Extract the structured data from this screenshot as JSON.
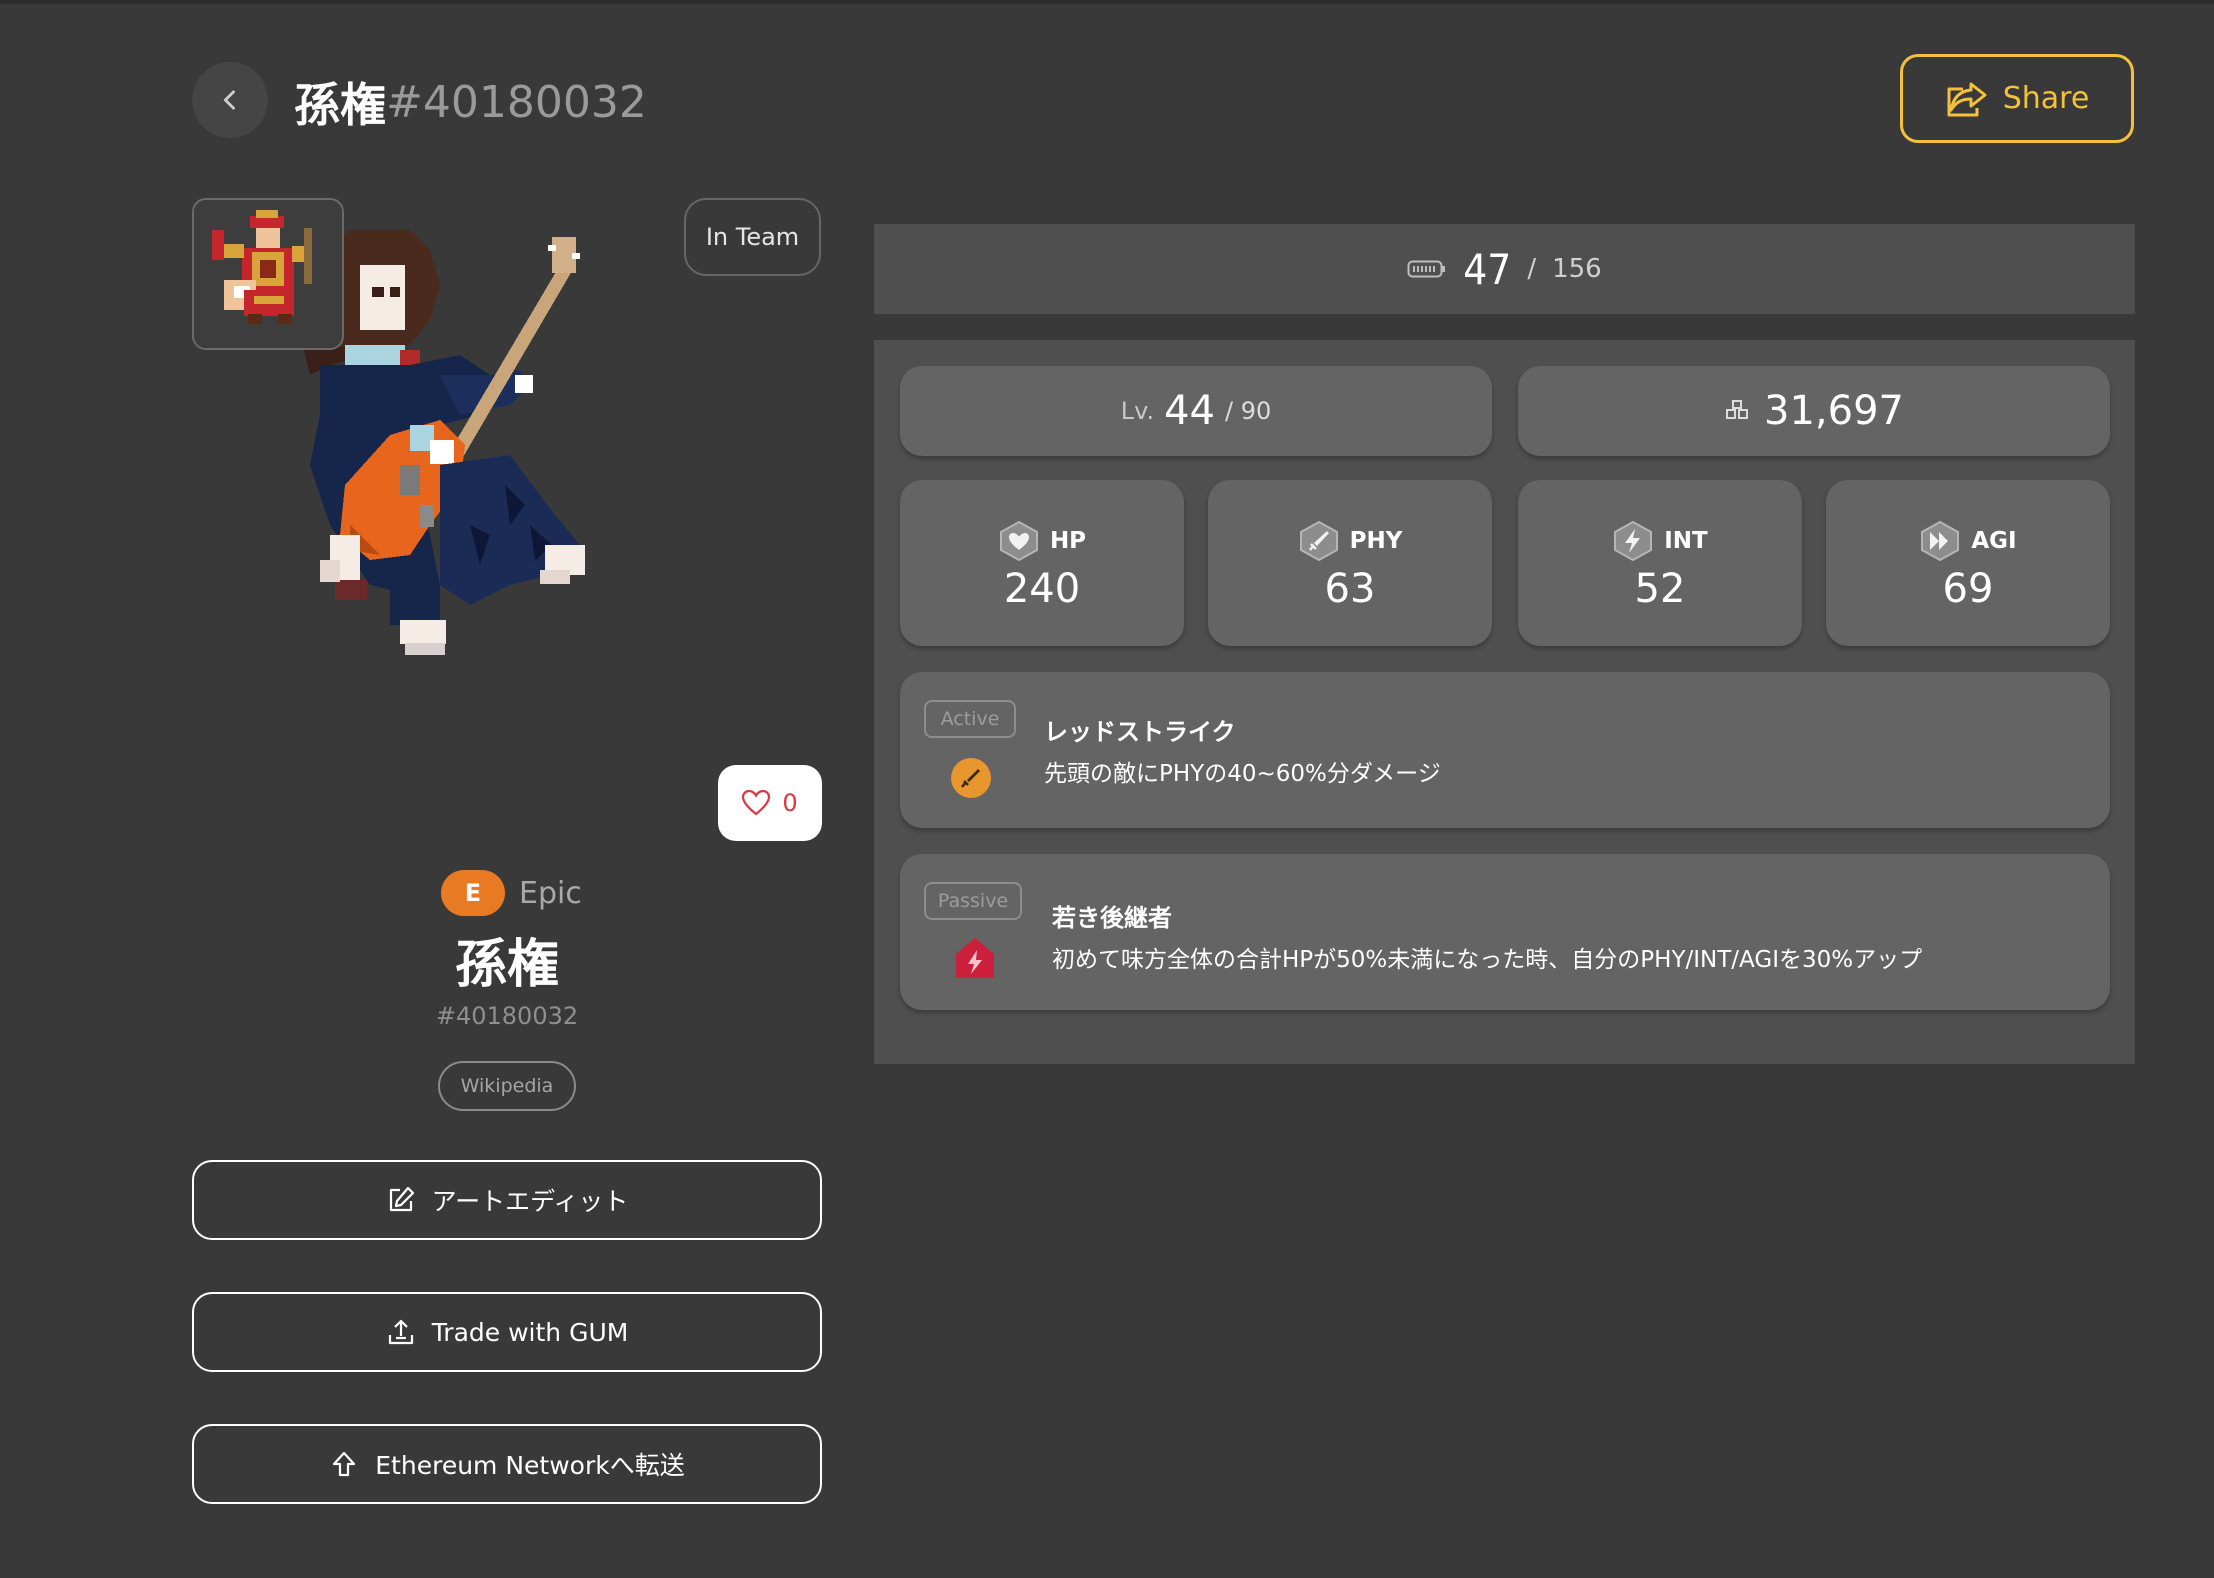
{
  "header": {
    "title_name": "孫権",
    "title_id": "#40180032",
    "share_label": "Share"
  },
  "hero": {
    "in_team_label": "In Team",
    "likes": "0",
    "rarity_letter": "E",
    "rarity_label": "Epic",
    "name": "孫権",
    "id": "#40180032",
    "wiki_label": "Wikipedia"
  },
  "actions": {
    "art_edit": "アートエディット",
    "trade": "Trade with GUM",
    "transfer": "Ethereum Networkへ転送"
  },
  "stamina": {
    "current": "47",
    "separator": "/",
    "max": "156"
  },
  "level": {
    "prefix": "Lv.",
    "value": "44",
    "max": "/ 90"
  },
  "power": {
    "value": "31,697"
  },
  "stats": [
    {
      "label": "HP",
      "value": "240",
      "icon": "heart-icon"
    },
    {
      "label": "PHY",
      "value": "63",
      "icon": "sword-icon"
    },
    {
      "label": "INT",
      "value": "52",
      "icon": "lightning-icon"
    },
    {
      "label": "AGI",
      "value": "69",
      "icon": "fast-forward-icon"
    }
  ],
  "skills": {
    "active": {
      "tag": "Active",
      "name": "レッドストライク",
      "desc": "先頭の敵にPHYの40~60%分ダメージ",
      "color": "#e8962e"
    },
    "passive": {
      "tag": "Passive",
      "name": "若き後継者",
      "desc": "初めて味方全体の合計HPが50%未満になった時、自分のPHY/INT/AGIを30%アップ",
      "color": "#cc1f3b"
    }
  },
  "colors": {
    "background": "#393939",
    "panel": "#4f4f4f",
    "card": "#646464",
    "accent": "#f3c23a",
    "rarity": "#e87a24",
    "like": "#e0353d"
  }
}
